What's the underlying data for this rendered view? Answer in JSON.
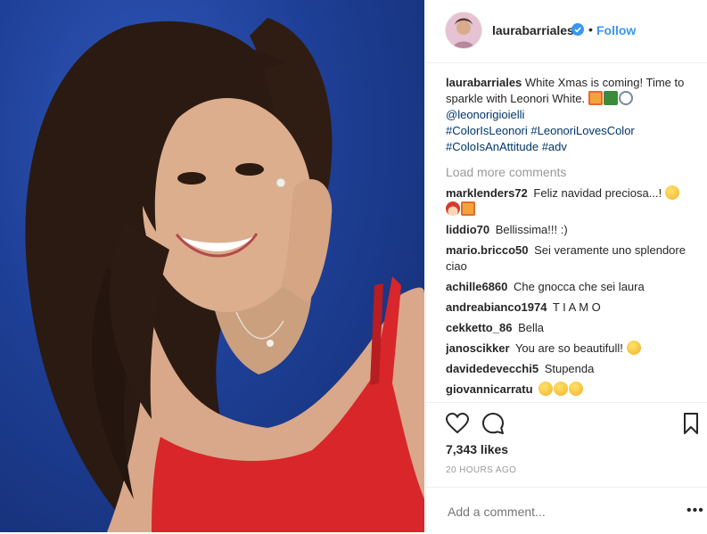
{
  "header": {
    "username": "laurabarriales",
    "separator": "•",
    "follow_label": "Follow",
    "verified_icon": "verified-badge-icon"
  },
  "caption": {
    "username": "laurabarriales",
    "text": "White Xmas is coming! Time to sparkle with Leonori White.",
    "emojis": [
      "gift-emoji",
      "christmas-tree-emoji",
      "ring-emoji"
    ],
    "mention": "@leonorigioielli",
    "hashtags": [
      "#ColorIsLeonori",
      "#LeonoriLovesColor",
      "#ColoIsAnAttitude",
      "#adv"
    ]
  },
  "load_more_label": "Load more comments",
  "comments": [
    {
      "user": "marklenders72",
      "text": "Feliz navidad preciosa...!"
    },
    {
      "user": "liddio70",
      "text": "Bellissima!!! :)"
    },
    {
      "user": "mario.bricco50",
      "text": "Sei veramente uno splendore ciao"
    },
    {
      "user": "achille6860",
      "text": "Che gnocca che sei laura"
    },
    {
      "user": "andreabianco1974",
      "text": "T I A M O"
    },
    {
      "user": "cekketto_86",
      "text": "Bella"
    },
    {
      "user": "janoscikker",
      "text": "You are so beautifull!"
    },
    {
      "user": "davidedevecchi5",
      "text": "Stupenda"
    },
    {
      "user": "giovannicarratu",
      "text": ""
    }
  ],
  "likes": "7,343 likes",
  "timestamp": "20 HOURS AGO",
  "add_comment_placeholder": "Add a comment...",
  "more_options": "•••",
  "colors": {
    "link": "#3897f0",
    "hashtag": "#003569",
    "muted": "#999999",
    "photo_background": "#1e3f96",
    "dress": "#d8262a"
  }
}
